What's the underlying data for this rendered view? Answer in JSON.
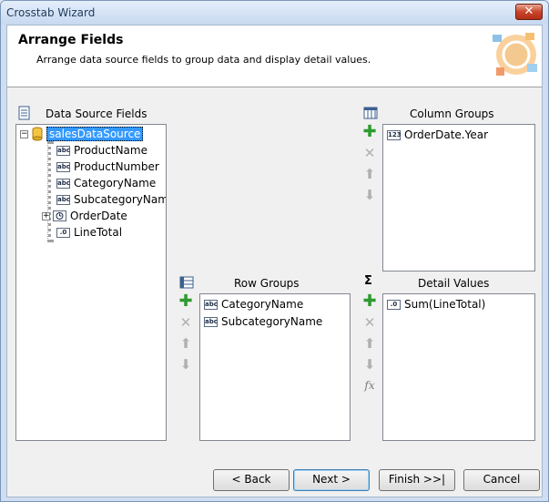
{
  "window": {
    "title": "Crosstab Wizard",
    "close_glyph": "✕"
  },
  "header": {
    "title": "Arrange Fields",
    "subtitle": "Arrange data source fields to group data and display detail values."
  },
  "data_source": {
    "label": "Data Source Fields",
    "root": "salesDataSource",
    "fields": [
      {
        "name": "ProductName",
        "icon": "abc"
      },
      {
        "name": "ProductNumber",
        "icon": "abc"
      },
      {
        "name": "CategoryName",
        "icon": "abc"
      },
      {
        "name": "SubcategoryName",
        "icon": "abc"
      },
      {
        "name": "OrderDate",
        "icon": "clock"
      },
      {
        "name": "LineTotal",
        "icon": ".0"
      }
    ]
  },
  "column_groups": {
    "label": "Column Groups",
    "items": [
      {
        "name": "OrderDate.Year",
        "icon": "123"
      }
    ]
  },
  "row_groups": {
    "label": "Row Groups",
    "items": [
      {
        "name": "CategoryName",
        "icon": "abc"
      },
      {
        "name": "SubcategoryName",
        "icon": "abc"
      }
    ]
  },
  "detail_values": {
    "label": "Detail Values",
    "icon_glyph": "Σ",
    "items": [
      {
        "name": "Sum(LineTotal)",
        "icon": ".0"
      }
    ]
  },
  "tools": {
    "add": "✚",
    "remove": "✕",
    "up": "⬆",
    "down": "⬇",
    "fx": "fx"
  },
  "buttons": {
    "back": "< Back",
    "next": "Next >",
    "finish": "Finish >>|",
    "cancel": "Cancel"
  }
}
